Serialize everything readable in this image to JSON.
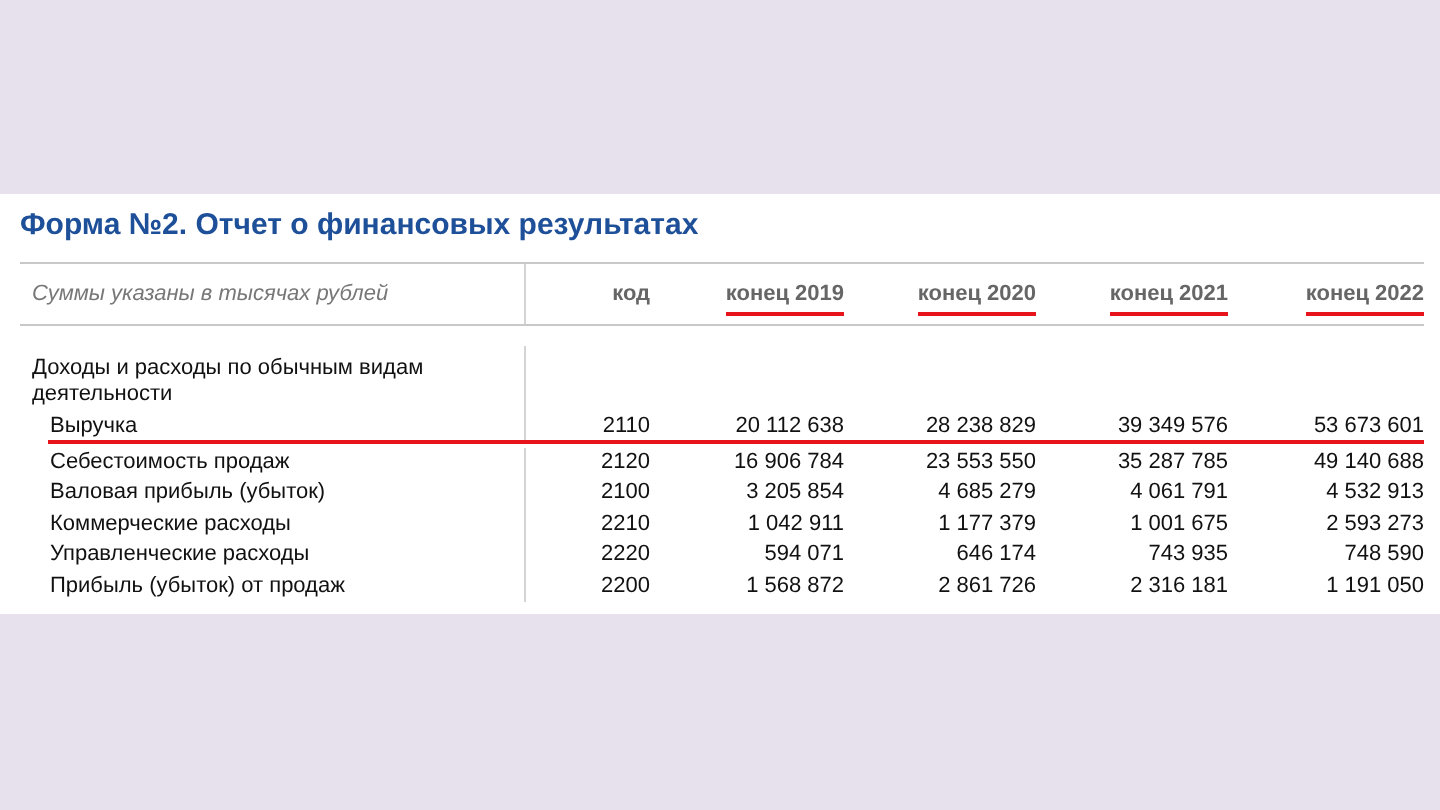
{
  "title": "Форма №2. Отчет о финансовых результатах",
  "table": {
    "note": "Суммы указаны в тысячах рублей",
    "columns": [
      {
        "label": "код",
        "underlined": false
      },
      {
        "label": "конец 2019",
        "underlined": true
      },
      {
        "label": "конец 2020",
        "underlined": true
      },
      {
        "label": "конец 2021",
        "underlined": true
      },
      {
        "label": "конец 2022",
        "underlined": true
      }
    ],
    "rows": [
      {
        "kind": "group",
        "label": "Доходы и расходы по обычным видам деятельности"
      },
      {
        "kind": "item",
        "label": "Выручка",
        "code": "2110",
        "values": [
          "20 112 638",
          "28 238 829",
          "39 349 576",
          "53 673 601"
        ],
        "underlined": true
      },
      {
        "kind": "item",
        "label": "Себестоимость продаж",
        "code": "2120",
        "values": [
          "16 906 784",
          "23 553 550",
          "35 287 785",
          "49 140 688"
        ],
        "underlined": false
      },
      {
        "kind": "item",
        "label": "Валовая прибыль (убыток)",
        "code": "2100",
        "values": [
          "3 205 854",
          "4 685 279",
          "4 061 791",
          "4 532 913"
        ],
        "underlined": false
      },
      {
        "kind": "item",
        "label": "Коммерческие расходы",
        "code": "2210",
        "values": [
          "1 042 911",
          "1 177 379",
          "1 001 675",
          "2 593 273"
        ],
        "underlined": false
      },
      {
        "kind": "item",
        "label": "Управленческие расходы",
        "code": "2220",
        "values": [
          "594 071",
          "646 174",
          "743 935",
          "748 590"
        ],
        "underlined": false
      },
      {
        "kind": "item",
        "label": "Прибыль (убыток) от продаж",
        "code": "2200",
        "values": [
          "1 568 872",
          "2 861 726",
          "2 316 181",
          "1 191 050"
        ],
        "underlined": false
      }
    ]
  }
}
